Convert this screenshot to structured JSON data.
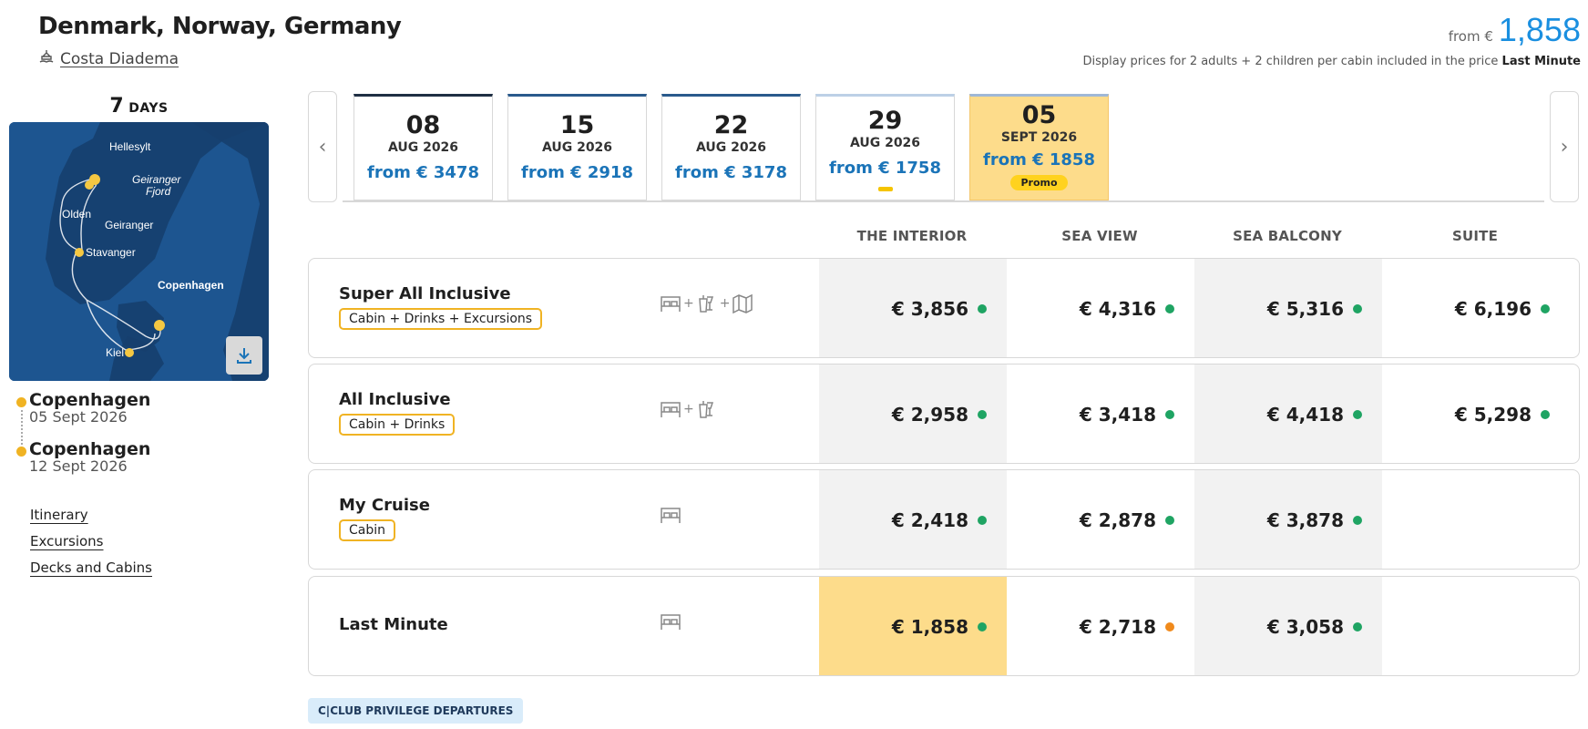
{
  "header": {
    "title": "Denmark, Norway, Germany",
    "ship": "Costa Diadema",
    "price_from_label": "from €",
    "price_amount": "1,858",
    "price_note": "Display prices for 2 adults + 2 children per cabin included in the price",
    "price_note_bold": "Last Minute"
  },
  "sidebar": {
    "days_number": "7",
    "days_unit": "DAYS",
    "map_labels": {
      "hellesylt": "Hellesylt",
      "geiranger_fjord_1": "Geiranger",
      "geiranger_fjord_2": "Fjord",
      "olden": "Olden",
      "geiranger": "Geiranger",
      "stavanger": "Stavanger",
      "copenhagen": "Copenhagen",
      "kiel": "Kiel"
    },
    "stops": [
      {
        "city": "Copenhagen",
        "date": "05 Sept 2026"
      },
      {
        "city": "Copenhagen",
        "date": "12 Sept 2026"
      }
    ],
    "links": [
      "Itinerary",
      "Excursions",
      "Decks and Cabins"
    ]
  },
  "dates": [
    {
      "day": "08",
      "month": "AUG 2026",
      "price": "from € 3478"
    },
    {
      "day": "15",
      "month": "AUG 2026",
      "price": "from € 2918"
    },
    {
      "day": "22",
      "month": "AUG 2026",
      "price": "from € 3178"
    },
    {
      "day": "29",
      "month": "AUG 2026",
      "price": "from € 1758"
    },
    {
      "day": "05",
      "month": "SEPT 2026",
      "price": "from € 1858",
      "badge": "Promo"
    }
  ],
  "columns": [
    "THE INTERIOR",
    "SEA VIEW",
    "SEA BALCONY",
    "SUITE"
  ],
  "packages": [
    {
      "name": "Super All Inclusive",
      "tag": "Cabin + Drinks + Excursions",
      "prices": [
        "€ 3,856",
        "€ 4,316",
        "€ 5,316",
        "€ 6,196"
      ]
    },
    {
      "name": "All Inclusive",
      "tag": "Cabin + Drinks",
      "prices": [
        "€ 2,958",
        "€ 3,418",
        "€ 4,418",
        "€ 5,298"
      ]
    },
    {
      "name": "My Cruise",
      "tag": "Cabin",
      "prices": [
        "€ 2,418",
        "€ 2,878",
        "€ 3,878"
      ]
    },
    {
      "name": "Last Minute",
      "prices": [
        "€ 1,858",
        "€ 2,718",
        "€ 3,058"
      ]
    }
  ],
  "availability_colors": {
    "available": "#1fa463",
    "limited": "#f08a1c"
  },
  "accent_colors": {
    "price_blue": "#1a8fe0",
    "highlight": "#fddc8b",
    "promo": "#ffd21f",
    "tag_border": "#f0b323"
  },
  "footer": {
    "club_label": "C|CLUB PRIVILEGE DEPARTURES"
  }
}
